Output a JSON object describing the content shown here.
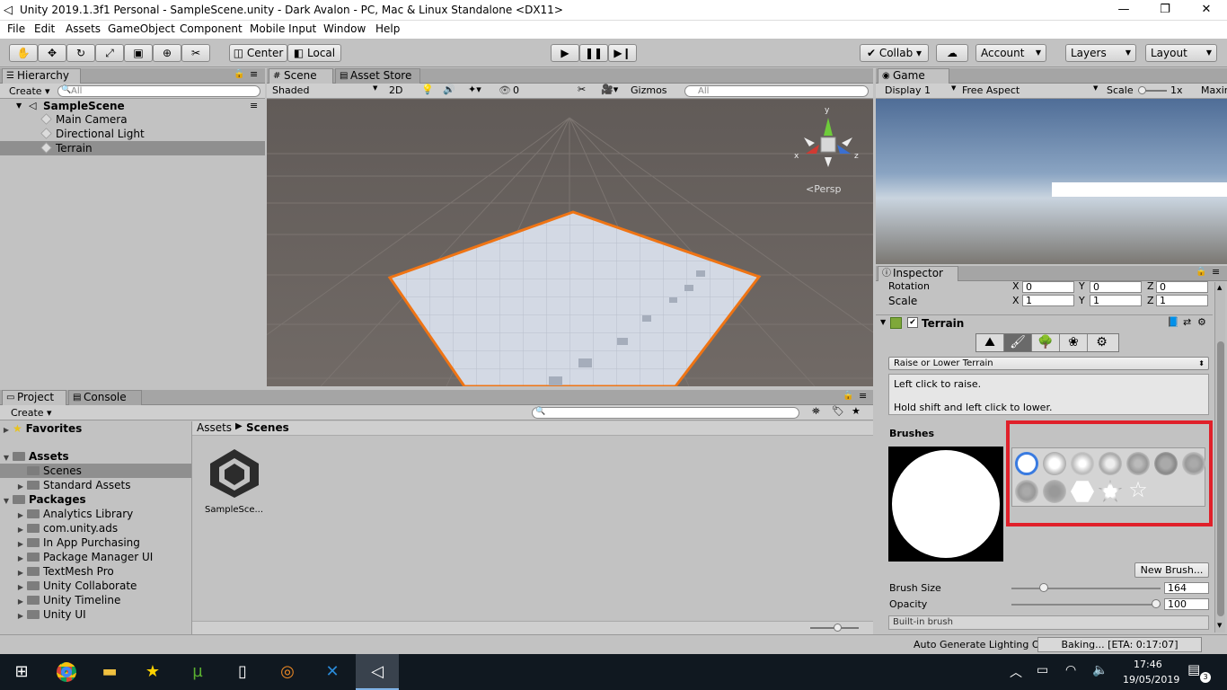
{
  "window": {
    "title": "Unity 2019.1.3f1 Personal - SampleScene.unity - Dark Avalon - PC, Mac & Linux Standalone <DX11>"
  },
  "menu": [
    "File",
    "Edit",
    "Assets",
    "GameObject",
    "Component",
    "Mobile Input",
    "Window",
    "Help"
  ],
  "toolbar": {
    "center": "Center",
    "local": "Local",
    "collab": "Collab ▾",
    "account": "Account",
    "layers": "Layers",
    "layout": "Layout"
  },
  "hierarchy": {
    "tab": "Hierarchy",
    "create": "Create ▾",
    "search_placeholder": "All",
    "scene": "SampleScene",
    "items": [
      "Main Camera",
      "Directional Light",
      "Terrain"
    ]
  },
  "scene": {
    "tab": "Scene",
    "store_tab": "Asset Store",
    "shading": "Shaded",
    "mode2d": "2D",
    "hidden_count": "0",
    "gizmos": "Gizmos",
    "search_placeholder": "All",
    "persp": "<Persp",
    "axis_x": "x",
    "axis_y": "y",
    "axis_z": "z"
  },
  "game": {
    "tab": "Game",
    "display": "Display 1",
    "aspect": "Free Aspect",
    "scale_label": "Scale",
    "scale_value": "1x",
    "maximize": "Maxin"
  },
  "project": {
    "tab": "Project",
    "console_tab": "Console",
    "create": "Create ▾",
    "favorites": "Favorites",
    "assets": "Assets",
    "scenes": "Scenes",
    "standard_assets": "Standard Assets",
    "packages": "Packages",
    "package_items": [
      "Analytics Library",
      "com.unity.ads",
      "In App Purchasing",
      "Package Manager UI",
      "TextMesh Pro",
      "Unity Collaborate",
      "Unity Timeline",
      "Unity UI"
    ],
    "breadcrumb_root": "Assets",
    "breadcrumb_leaf": "Scenes",
    "asset_name": "SampleSce..."
  },
  "inspector": {
    "tab": "Inspector",
    "rotation_label": "Rotation",
    "scale_label": "Scale",
    "rot_x": "0",
    "rot_y": "0",
    "rot_z": "0",
    "scale_x": "1",
    "scale_y": "1",
    "scale_z": "1",
    "axis_x": "X",
    "axis_y": "Y",
    "axis_z": "Z",
    "component": "Terrain",
    "tool_dropdown": "Raise or Lower Terrain",
    "help_line1": "Left click to raise.",
    "help_line2": "Hold shift and left click to lower.",
    "brushes_label": "Brushes",
    "new_brush": "New Brush...",
    "brush_size_label": "Brush Size",
    "brush_size": "164",
    "brush_size_fraction": 0.2,
    "opacity_label": "Opacity",
    "opacity": "100",
    "opacity_fraction": 1.0,
    "builtin": "Built-in brush",
    "highlight_color": "#e0202a"
  },
  "status": {
    "lighting": "Auto Generate Lighting On",
    "baking": "Baking... [ETA: 0:17:07]"
  },
  "taskbar": {
    "time": "17:46",
    "date": "19/05/2019",
    "notif": "3"
  }
}
